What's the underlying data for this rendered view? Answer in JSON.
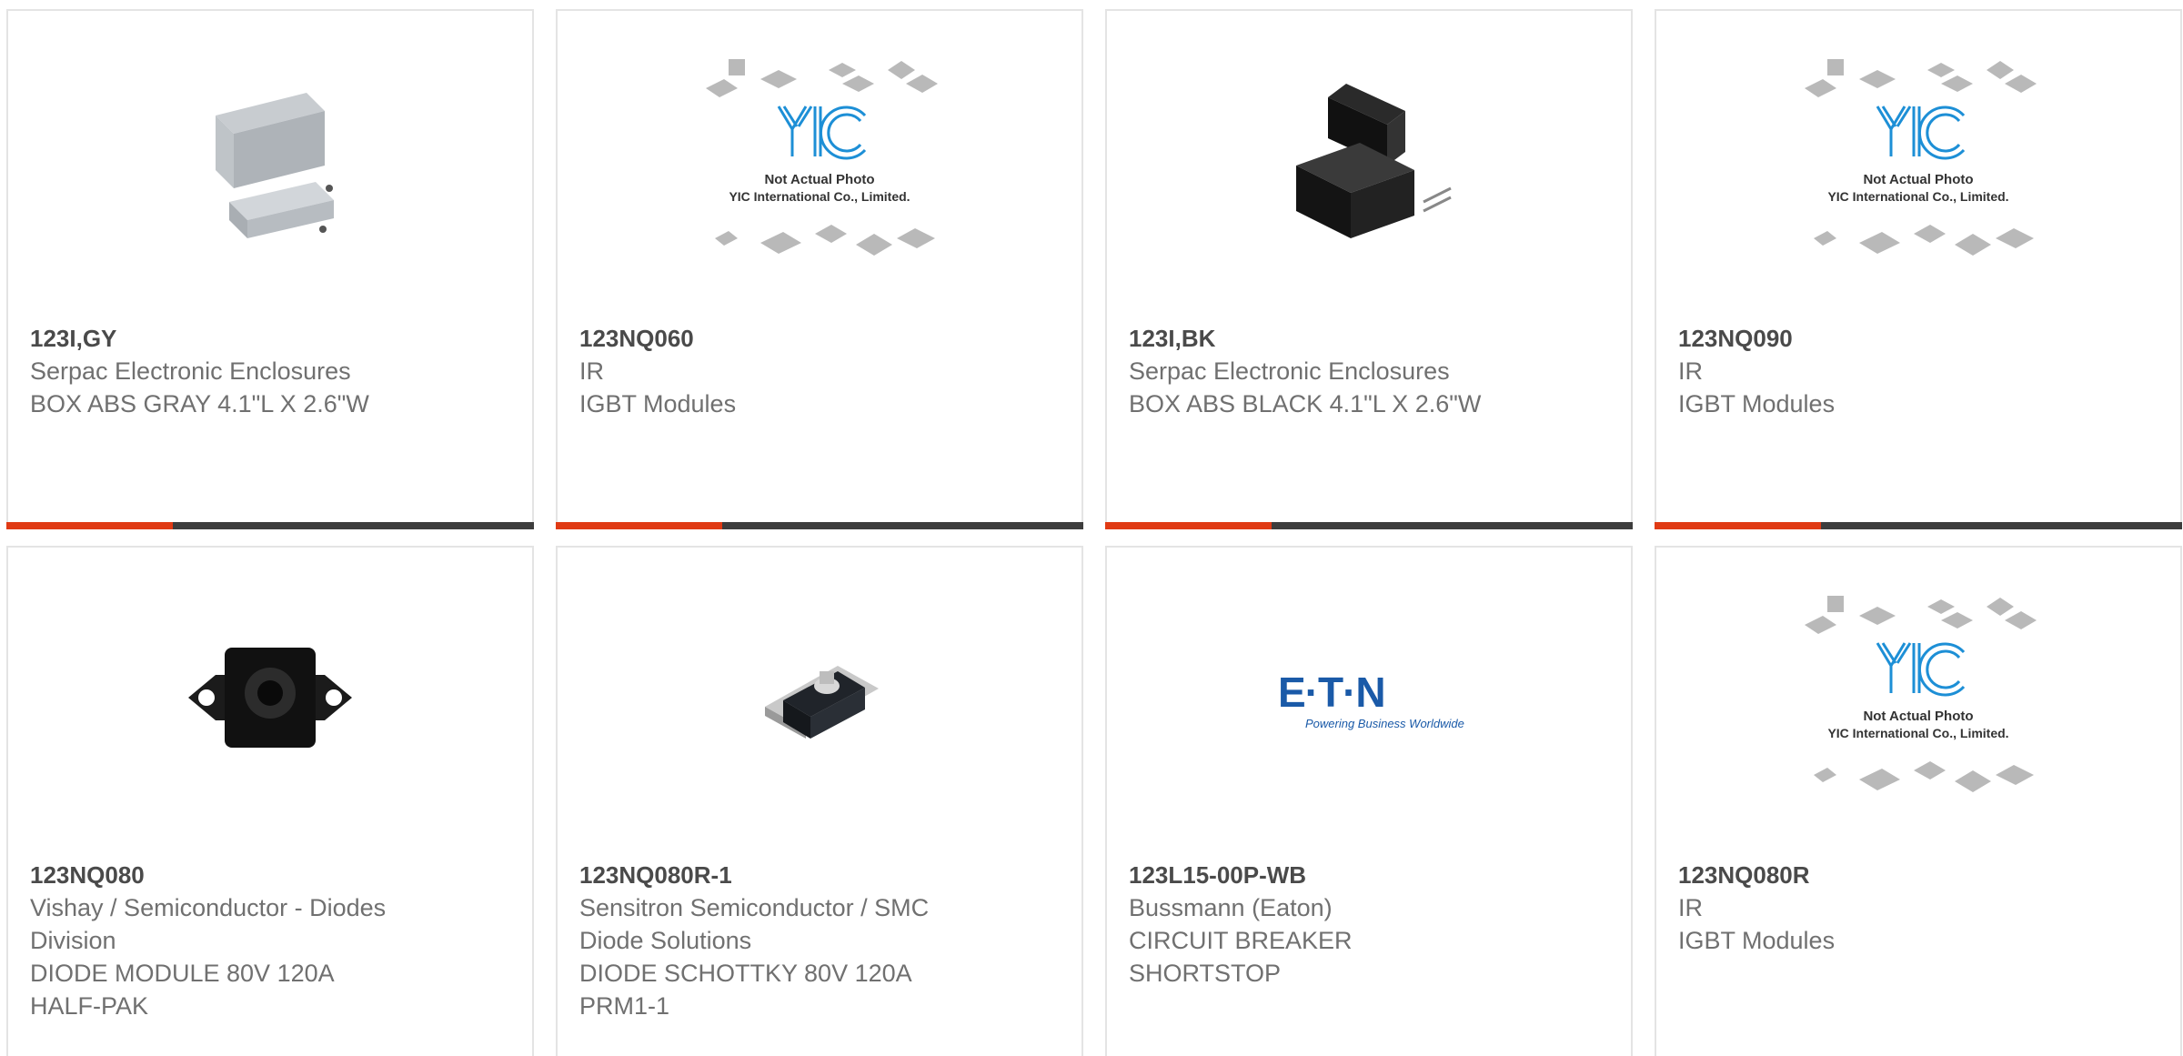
{
  "colors": {
    "accent": "#e03a14",
    "dark": "#3d3d3d",
    "border": "#e4e4e4",
    "pn": "#4a4a4a",
    "text": "#707070"
  },
  "placeholder": {
    "line1": "Not Actual Photo",
    "line2": "YIC International Co., Limited.",
    "logo": "YIC"
  },
  "eaton": {
    "logo": "E·T·N",
    "tagline": "Powering Business Worldwide"
  },
  "products": [
    {
      "pn": "123I,GY",
      "lines": [
        "Serpac Electronic Enclosures",
        "BOX ABS GRAY 4.1\"L X 2.6\"W"
      ],
      "image": "gray-enclosure-icon"
    },
    {
      "pn": "123NQ060",
      "lines": [
        "IR",
        "IGBT Modules"
      ],
      "image": "yic-placeholder-icon"
    },
    {
      "pn": "123I,BK",
      "lines": [
        "Serpac Electronic Enclosures",
        "BOX ABS BLACK 4.1\"L X 2.6\"W"
      ],
      "image": "black-enclosure-icon"
    },
    {
      "pn": "123NQ090",
      "lines": [
        "IR",
        "IGBT Modules"
      ],
      "image": "yic-placeholder-icon"
    },
    {
      "pn": "123NQ080",
      "lines": [
        "Vishay / Semiconductor - Diodes",
        "Division",
        "DIODE MODULE 80V 120A",
        "HALF-PAK"
      ],
      "image": "diode-module-icon"
    },
    {
      "pn": "123NQ080R-1",
      "lines": [
        "Sensitron Semiconductor / SMC",
        "Diode Solutions",
        "DIODE SCHOTTKY 80V 120A",
        "PRM1-1"
      ],
      "image": "schottky-module-icon"
    },
    {
      "pn": "123L15-00P-WB",
      "lines": [
        "Bussmann (Eaton)",
        "CIRCUIT BREAKER",
        "SHORTSTOP"
      ],
      "image": "eaton-logo-icon"
    },
    {
      "pn": "123NQ080R",
      "lines": [
        "IR",
        "IGBT Modules"
      ],
      "image": "yic-placeholder-icon"
    }
  ]
}
